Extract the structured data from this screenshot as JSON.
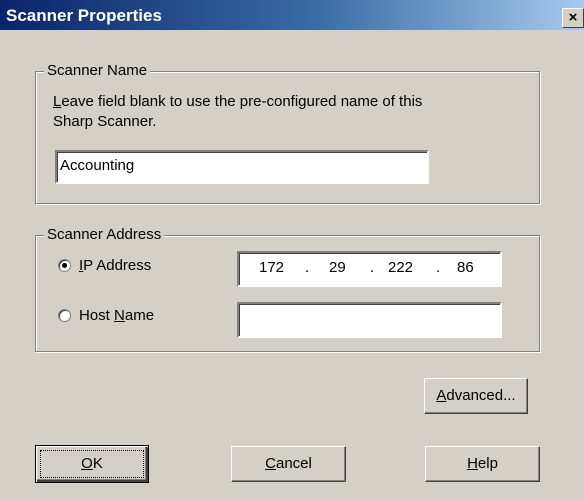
{
  "window": {
    "title": "Scanner Properties",
    "close_glyph": "×"
  },
  "scanner_name": {
    "legend": "Scanner Name",
    "description_line1_mnemonic": "L",
    "description_line1_rest": "eave field blank to use the pre-configured name of this",
    "description_line2": "Sharp Scanner.",
    "value": "Accounting"
  },
  "scanner_address": {
    "legend": "Scanner Address",
    "ip_label_mnemonic": "I",
    "ip_label_rest": "P Address",
    "ip_octets": [
      "172",
      "29",
      "222",
      "86"
    ],
    "ip_dot": ".",
    "host_label_pre": "Host ",
    "host_label_mnemonic": "N",
    "host_label_post": "ame",
    "host_value": "",
    "selected": "ip"
  },
  "buttons": {
    "advanced_mnemonic": "A",
    "advanced_rest": "dvanced...",
    "ok_mnemonic": "O",
    "ok_rest": "K",
    "cancel_mnemonic": "C",
    "cancel_rest": "ancel",
    "help_mnemonic": "H",
    "help_rest": "elp"
  }
}
